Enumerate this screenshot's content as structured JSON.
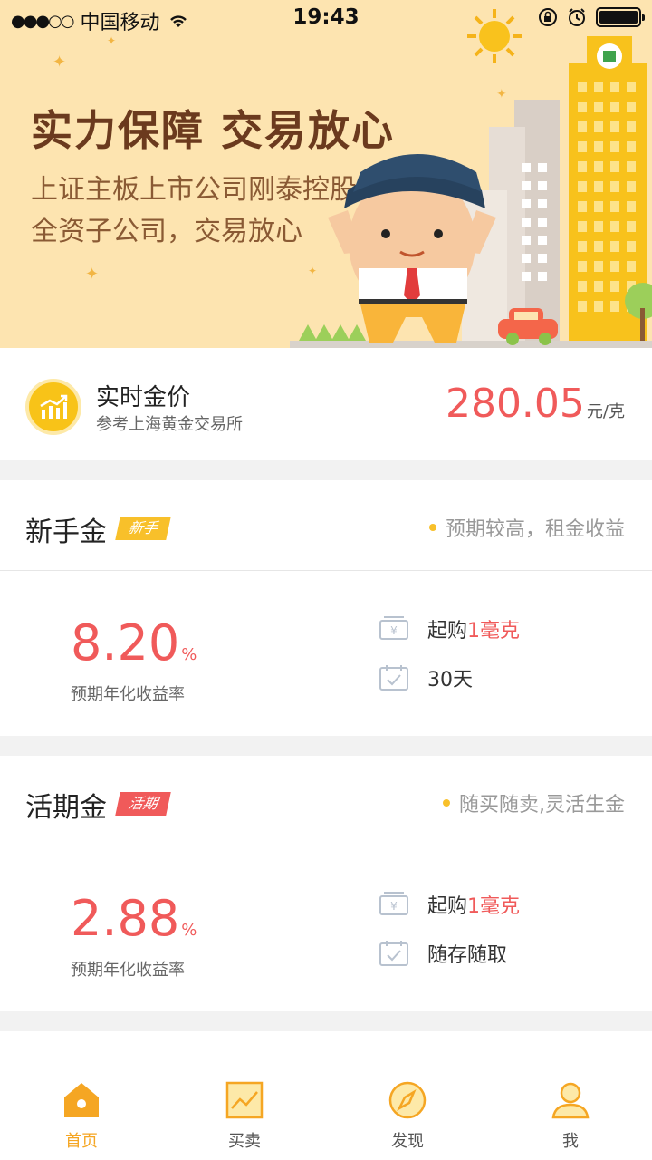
{
  "status_bar": {
    "carrier": "中国移动",
    "time": "19:43"
  },
  "banner": {
    "title": "实力保障  交易放心",
    "subtitle_line1": "上证主板上市公司刚泰控股",
    "subtitle_line2": "全资子公司，交易放心"
  },
  "gold_price": {
    "title": "实时金价",
    "source": "参考上海黄金交易所",
    "value": "280.05",
    "unit": "元/克"
  },
  "products": [
    {
      "name": "新手金",
      "tag": "新手",
      "desc": "预期较高，租金收益",
      "rate": "8.20",
      "rate_unit": "%",
      "rate_label": "预期年化收益率",
      "min_prefix": "起购",
      "min_value": "1毫克",
      "term": "30天"
    },
    {
      "name": "活期金",
      "tag": "活期",
      "desc": "随买随卖,灵活生金",
      "rate": "2.88",
      "rate_unit": "%",
      "rate_label": "预期年化收益率",
      "min_prefix": "起购",
      "min_value": "1毫克",
      "term": "随存随取"
    }
  ],
  "tabbar": {
    "items": [
      {
        "label": "首页",
        "icon": "home-icon",
        "active": true
      },
      {
        "label": "买卖",
        "icon": "trade-chart-icon",
        "active": false
      },
      {
        "label": "发现",
        "icon": "compass-icon",
        "active": false
      },
      {
        "label": "我",
        "icon": "user-icon",
        "active": false
      }
    ]
  },
  "colors": {
    "accent": "#f5a623",
    "price_red": "#f05a5a",
    "banner_bg": "#fde4b0"
  }
}
